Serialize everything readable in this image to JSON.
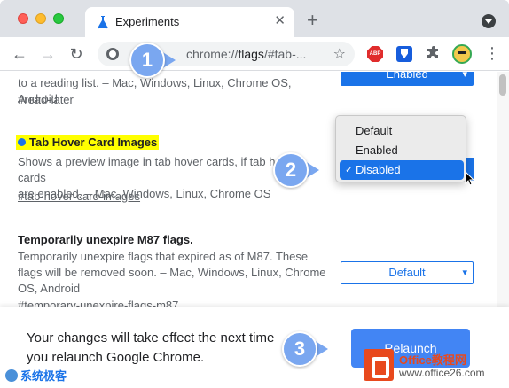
{
  "tab": {
    "title": "Experiments",
    "close": "✕"
  },
  "toolbar": {
    "back": "←",
    "forward": "→",
    "reload": "↻",
    "url_prefix": "chrome://",
    "url_host": "flags",
    "url_suffix": "/#tab-...",
    "star": "☆",
    "more": "⋮",
    "new_tab": "+",
    "ext_abp": "ABP"
  },
  "flags": {
    "read_later": {
      "desc": "to a reading list. – Mac, Windows, Linux, Chrome OS, Android",
      "link": "#read-later",
      "value": "Enabled"
    },
    "tab_hover": {
      "title": "Tab Hover Card Images",
      "desc_line1": "Shows a preview image in tab hover cards, if tab hover cards",
      "desc_line2": "are enabled. – Mac, Windows, Linux, Chrome OS",
      "link": "#tab-hover-card-images"
    },
    "unexpire": {
      "title": "Temporarily unexpire M87 flags.",
      "desc": "Temporarily unexpire flags that expired as of M87. These flags will be removed soon. – Mac, Windows, Linux, Chrome OS, Android",
      "link": "#temporary-unexpire-flags-m87",
      "value": "Default"
    }
  },
  "dropdown": {
    "options": [
      "Default",
      "Enabled",
      "Disabled"
    ],
    "selected": "Disabled",
    "check": "✓"
  },
  "relaunch": {
    "message": "Your changes will take effect the next time you relaunch Google Chrome.",
    "button": "Relaunch"
  },
  "callouts": [
    "1",
    "2",
    "3"
  ],
  "watermarks": {
    "left": "系统极客",
    "right_title": "Office教程网",
    "right_url": "www.office26.com"
  },
  "colors": {
    "accent": "#1a73e8",
    "relaunch_button": "#4285f4",
    "highlight": "#ffff00",
    "callout": "#7aa7f0"
  }
}
